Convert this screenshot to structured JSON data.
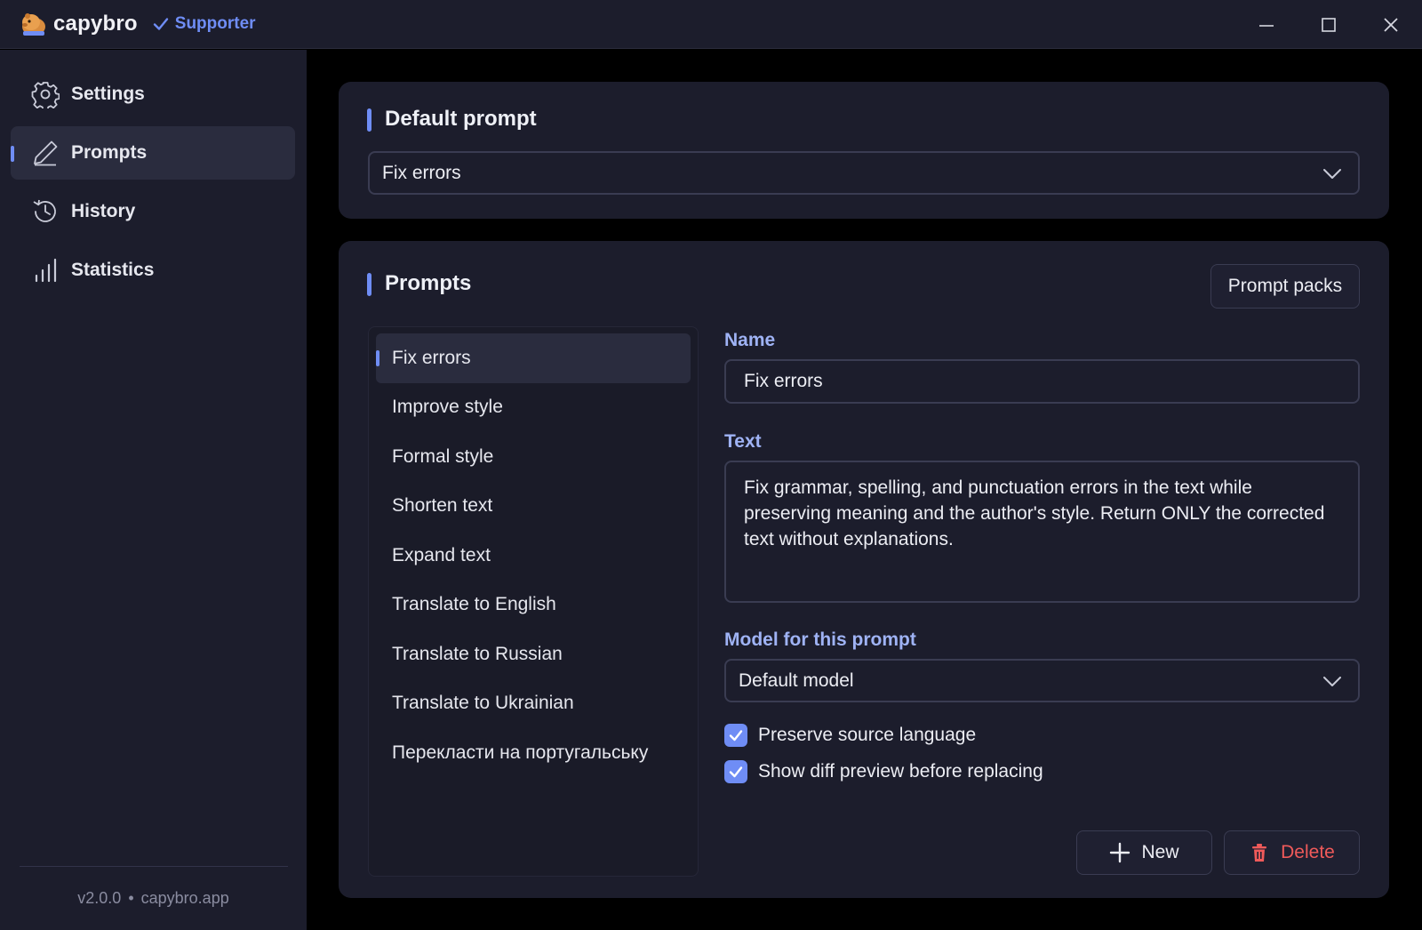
{
  "app": {
    "name": "capybro",
    "badge": "Supporter",
    "colors": {
      "accent": "#6f8df5",
      "danger": "#f05a5a",
      "surface": "#1c1d2c",
      "background": "#000000"
    }
  },
  "window_controls": [
    "minimize-icon",
    "maximize-icon",
    "close-icon"
  ],
  "sidebar": {
    "items": [
      {
        "label": "Settings",
        "icon": "gear-icon"
      },
      {
        "label": "Prompts",
        "icon": "pen-icon",
        "active": true
      },
      {
        "label": "History",
        "icon": "history-icon"
      },
      {
        "label": "Statistics",
        "icon": "bar-chart-icon"
      }
    ],
    "footer": {
      "version": "v2.0.0",
      "separator": "•",
      "site": "capybro.app"
    }
  },
  "default_prompt": {
    "title": "Default prompt",
    "selected": "Fix errors"
  },
  "prompts": {
    "title": "Prompts",
    "packs_button": "Prompt packs",
    "list": [
      "Fix errors",
      "Improve style",
      "Formal style",
      "Shorten text",
      "Expand text",
      "Translate to English",
      "Translate to Russian",
      "Translate to Ukrainian",
      "Перекласти на португальську"
    ],
    "active_index": 0,
    "editor": {
      "name_label": "Name",
      "name_value": "Fix errors",
      "text_label": "Text",
      "text_value": "Fix grammar, spelling, and punctuation errors in the text while preserving meaning and the author's style. Return ONLY the corrected text without explanations.",
      "model_label": "Model for this prompt",
      "model_value": "Default model",
      "options": [
        {
          "label": "Preserve source language",
          "checked": true
        },
        {
          "label": "Show diff preview before replacing",
          "checked": true
        }
      ],
      "new_button": "New",
      "delete_button": "Delete"
    }
  }
}
